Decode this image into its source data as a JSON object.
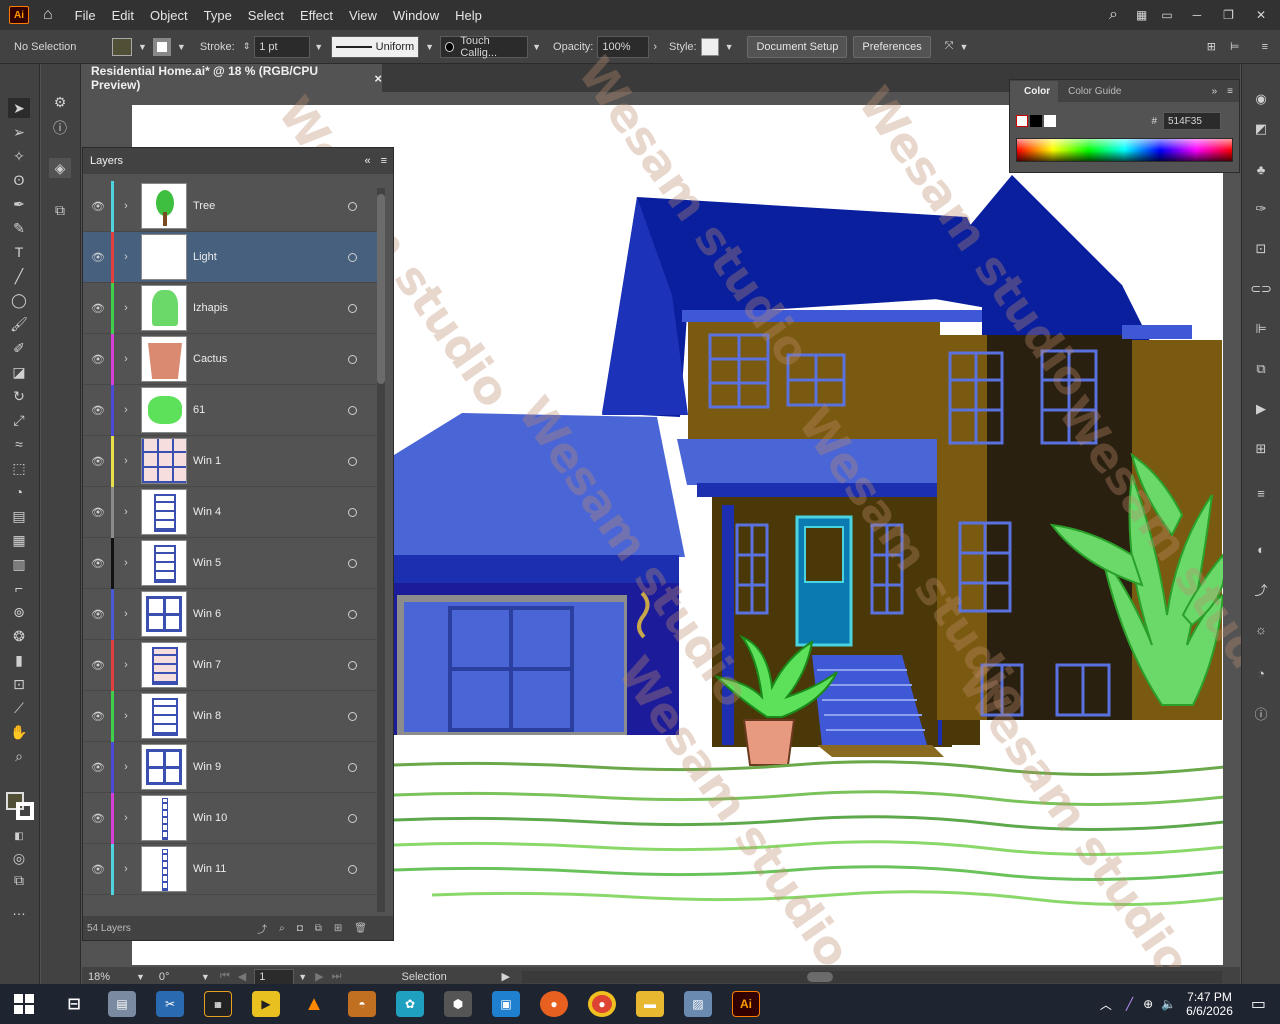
{
  "app": {
    "logo": "Ai",
    "menus": [
      "File",
      "Edit",
      "Object",
      "Type",
      "Select",
      "Effect",
      "View",
      "Window",
      "Help"
    ]
  },
  "control": {
    "selection": "No Selection",
    "stroke_label": "Stroke:",
    "stroke_value": "1 pt",
    "profile": "Uniform",
    "brush": "Touch Callig...",
    "opacity_label": "Opacity:",
    "opacity_value": "100%",
    "style_label": "Style:",
    "doc_setup": "Document Setup",
    "preferences": "Preferences"
  },
  "document": {
    "tab_title": "Residential Home.ai* @ 18 % (RGB/CPU Preview)",
    "close": "×"
  },
  "layers": {
    "title": "Layers",
    "count": "54 Layers",
    "items": [
      {
        "name": "Tree",
        "color": "#4fd3e0"
      },
      {
        "name": "Light",
        "color": "#e0413f"
      },
      {
        "name": "Izhapis",
        "color": "#3fcf4a"
      },
      {
        "name": "Cactus",
        "color": "#d63fd6"
      },
      {
        "name": "61",
        "color": "#4a4ad6"
      },
      {
        "name": "Win 1",
        "color": "#e8e04a"
      },
      {
        "name": "Win 4",
        "color": "#8c8c8c"
      },
      {
        "name": "Win 5",
        "color": "#111111"
      },
      {
        "name": "Win 6",
        "color": "#4a5ad6"
      },
      {
        "name": "Win 7",
        "color": "#e0413f"
      },
      {
        "name": "Win 8",
        "color": "#3fcf4a"
      },
      {
        "name": "Win 9",
        "color": "#4a4ad6"
      },
      {
        "name": "Win 10",
        "color": "#d63fd6"
      },
      {
        "name": "Win 11",
        "color": "#4fd3e0"
      }
    ]
  },
  "color_panel": {
    "tab_color": "Color",
    "tab_guide": "Color Guide",
    "hex_prefix": "#",
    "hex": "514F35"
  },
  "status": {
    "zoom": "18%",
    "rotate": "0°",
    "artboard": "1",
    "tool": "Selection"
  },
  "taskbar": {
    "time": "7:47 PM",
    "date": "6/6/2026"
  },
  "watermark": "Wesam studio"
}
